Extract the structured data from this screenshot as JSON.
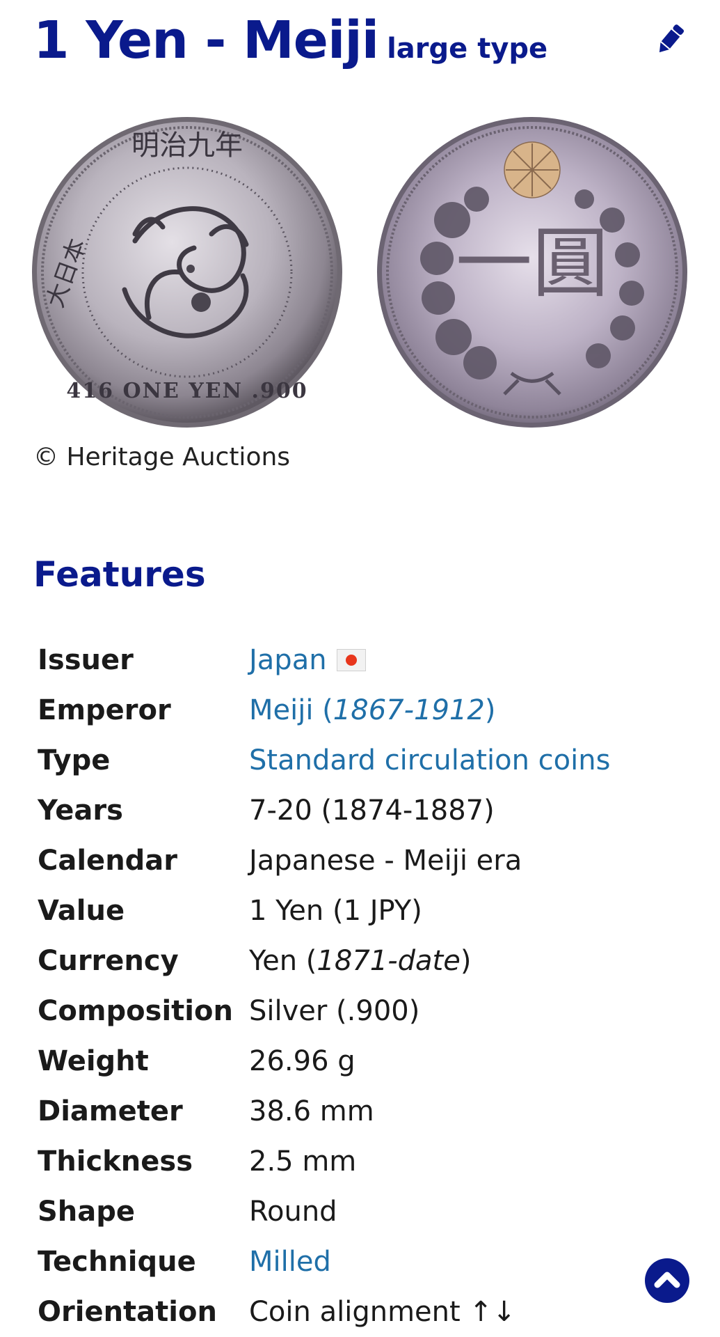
{
  "header": {
    "title": "1 Yen - Meiji",
    "subtitle": "large type",
    "edit_icon": "pencil-icon"
  },
  "images": {
    "obverse_alt": "Obverse: dragon coin",
    "reverse_alt": "Reverse: chrysanthemum wreath",
    "obverse_legend_top": "明治九年",
    "obverse_legend_left": "大日本",
    "obverse_legend_bottom": "416 ONE YEN .900",
    "reverse_center": "一圓"
  },
  "credit": "© Heritage Auctions",
  "features_heading": "Features",
  "features": {
    "issuer": {
      "label": "Issuer",
      "value": "Japan"
    },
    "emperor": {
      "label": "Emperor",
      "name": "Meiji",
      "years": "1867-1912"
    },
    "type": {
      "label": "Type",
      "value": "Standard circulation coins"
    },
    "years": {
      "label": "Years",
      "value": "7-20 (1874-1887)"
    },
    "calendar": {
      "label": "Calendar",
      "value": "Japanese - Meiji era"
    },
    "value": {
      "label": "Value",
      "value": "1 Yen (1 JPY)"
    },
    "currency": {
      "label": "Currency",
      "name": "Yen",
      "years": "1871-date"
    },
    "composition": {
      "label": "Composition",
      "value": "Silver (.900)"
    },
    "weight": {
      "label": "Weight",
      "value": "26.96 g"
    },
    "diameter": {
      "label": "Diameter",
      "value": "38.6 mm"
    },
    "thickness": {
      "label": "Thickness",
      "value": "2.5 mm"
    },
    "shape": {
      "label": "Shape",
      "value": "Round"
    },
    "technique": {
      "label": "Technique",
      "value": "Milled"
    },
    "orientation": {
      "label": "Orientation",
      "value": "Coin alignment ↑↓"
    }
  },
  "colors": {
    "heading": "#0a1a8c",
    "link": "#1f6fa8",
    "text": "#1a1a1a",
    "flag_red": "#e8361c"
  },
  "icons": {
    "scroll_top": "chevron-up-icon",
    "flag": "japan-flag-icon"
  }
}
